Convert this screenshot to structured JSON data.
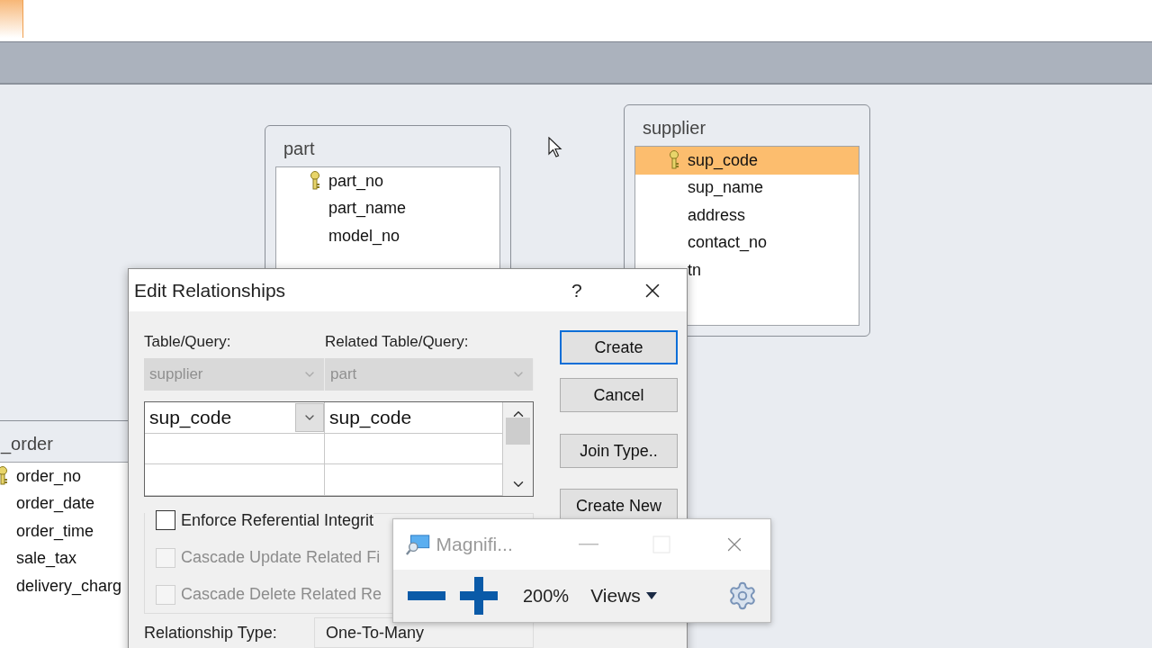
{
  "tables": [
    {
      "title": "part",
      "fields": [
        {
          "name": "part_no",
          "primary_key": true,
          "selected": false
        },
        {
          "name": "part_name",
          "primary_key": false,
          "selected": false
        },
        {
          "name": "model_no",
          "primary_key": false,
          "selected": false
        }
      ]
    },
    {
      "title": "supplier",
      "fields": [
        {
          "name": "sup_code",
          "primary_key": true,
          "selected": true
        },
        {
          "name": "sup_name",
          "primary_key": false,
          "selected": false
        },
        {
          "name": "address",
          "primary_key": false,
          "selected": false
        },
        {
          "name": "contact_no",
          "primary_key": false,
          "selected": false
        },
        {
          "name": "tn",
          "primary_key": false,
          "selected": false
        }
      ]
    },
    {
      "title": "_order",
      "fields": [
        {
          "name": "order_no",
          "primary_key": true,
          "selected": false
        },
        {
          "name": "order_date",
          "primary_key": false,
          "selected": false
        },
        {
          "name": "order_time",
          "primary_key": false,
          "selected": false
        },
        {
          "name": "sale_tax",
          "primary_key": false,
          "selected": false
        },
        {
          "name": "delivery_charg",
          "primary_key": false,
          "selected": false
        }
      ]
    }
  ],
  "dialog": {
    "title": "Edit Relationships",
    "help": "?",
    "table_label": "Table/Query:",
    "table_value": "supplier",
    "related_label": "Related Table/Query:",
    "related_value": "part",
    "rows": [
      {
        "field": "sup_code",
        "related": "sup_code"
      }
    ],
    "buttons": [
      {
        "label": "Create",
        "default": true
      },
      {
        "label": "Cancel",
        "default": false
      },
      {
        "label": "Join Type..",
        "default": false
      },
      {
        "label": "Create New",
        "default": false
      }
    ],
    "options": [
      {
        "label": "Enforce Referential Integrit",
        "checked": false,
        "disabled": false
      },
      {
        "label": "Cascade Update Related Fi",
        "checked": false,
        "disabled": true
      },
      {
        "label": "Cascade Delete Related Re",
        "checked": false,
        "disabled": true
      }
    ],
    "relationship_label": "Relationship Type:",
    "relationship_value": "One-To-Many"
  },
  "magnifier": {
    "title": "Magnifi...",
    "zoom": "200%",
    "views": "Views"
  }
}
